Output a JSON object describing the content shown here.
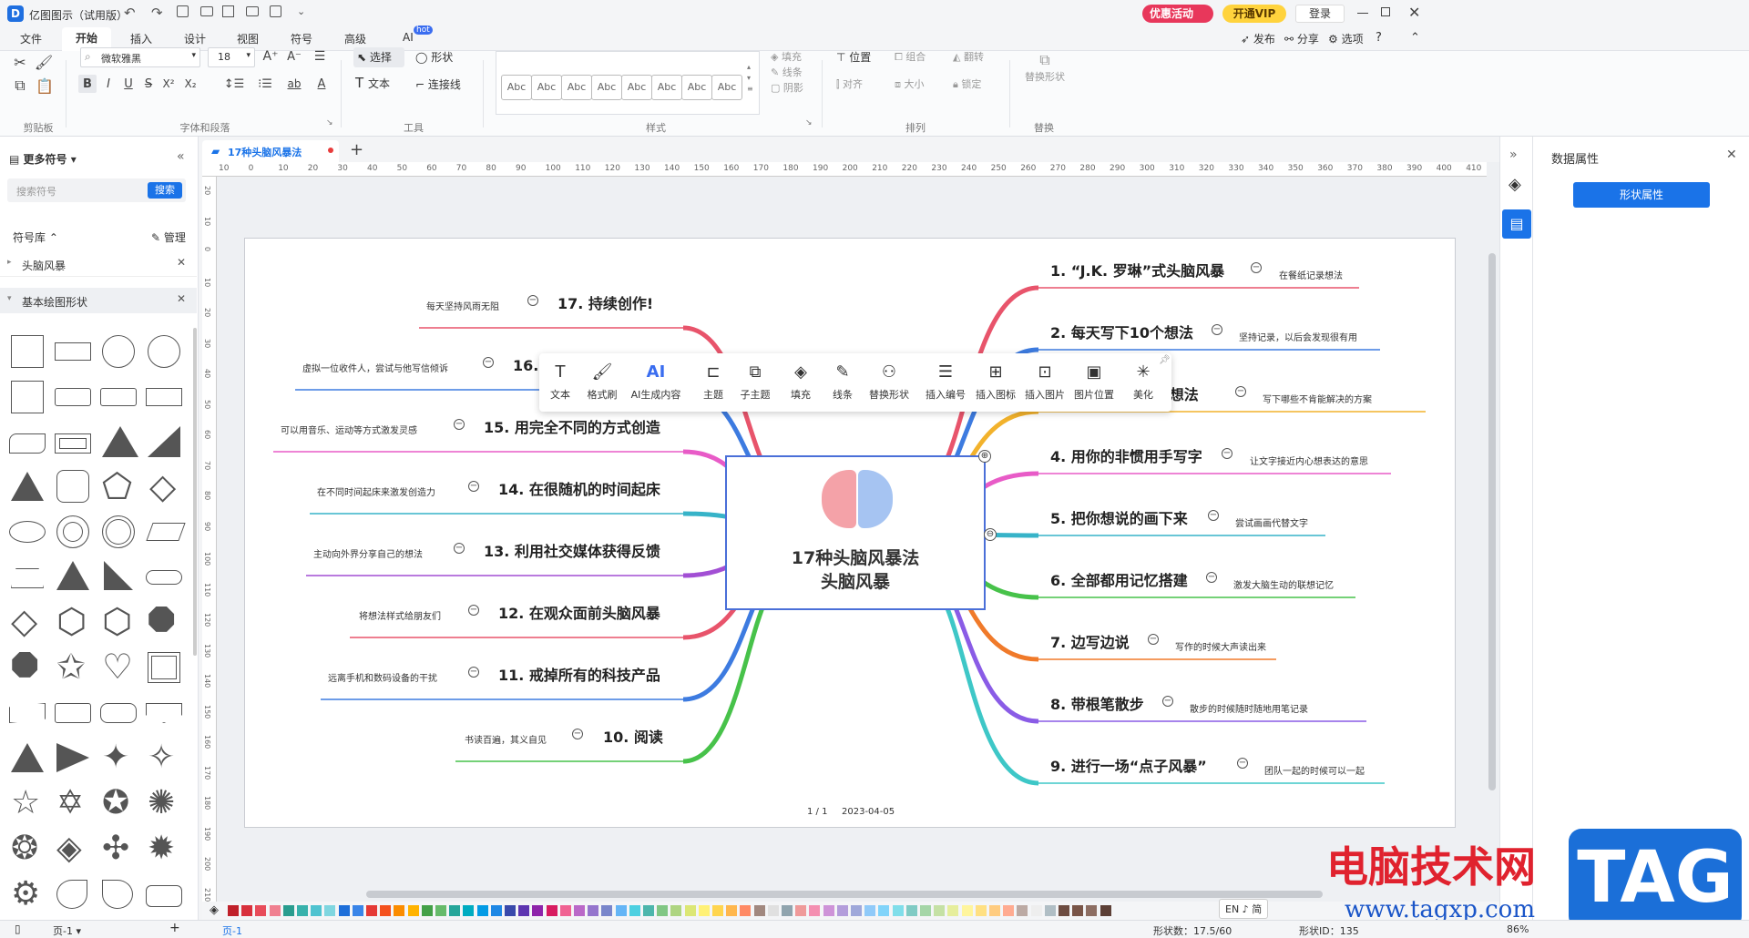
{
  "titlebar": {
    "app_title": "亿图图示（试用版）",
    "promo": "优惠活动",
    "vip": "开通VIP",
    "login": "登录"
  },
  "menu": {
    "items": [
      "文件",
      "开始",
      "插入",
      "设计",
      "视图",
      "符号",
      "高级",
      "AI"
    ],
    "ai_badge": "hot",
    "active": "开始",
    "right": [
      "发布",
      "分享",
      "选项"
    ]
  },
  "ribbon": {
    "font_name": "微软雅黑",
    "font_size": "18",
    "select": "选择",
    "shape": "形状",
    "text": "文本",
    "connector": "连接线",
    "fill": "填充",
    "line": "线条",
    "shadow": "阴影",
    "position": "位置",
    "group": "组合",
    "flip": "翻转",
    "align": "对齐",
    "size": "大小",
    "lock": "锁定",
    "replace_shape": "替换形状",
    "style_sample": "Abc",
    "groups": [
      "剪贴板",
      "字体和段落",
      "工具",
      "样式",
      "排列",
      "替换"
    ]
  },
  "left": {
    "more_symbols": "更多符号",
    "search_placeholder": "搜索符号",
    "search_btn": "搜索",
    "library": "符号库",
    "manage": "管理",
    "lib_items": [
      "头脑风暴",
      "基本绘图形状"
    ]
  },
  "tab": {
    "name": "17种头脑风暴法"
  },
  "ruler": {
    "ticks": [
      "10",
      "0",
      "10",
      "20",
      "30",
      "40",
      "50",
      "60",
      "70",
      "80",
      "90",
      "100",
      "110",
      "120",
      "130",
      "140",
      "150",
      "160",
      "170",
      "180",
      "190",
      "200",
      "210",
      "220",
      "230",
      "240",
      "250",
      "260",
      "270",
      "280",
      "290",
      "300",
      "310",
      "320",
      "330",
      "340",
      "350",
      "360",
      "370",
      "380",
      "390",
      "400",
      "410"
    ]
  },
  "vruler": {
    "ticks": [
      "20",
      "10",
      "0",
      "10",
      "20",
      "30",
      "40",
      "50",
      "60",
      "70",
      "80",
      "90",
      "100",
      "110",
      "120",
      "130",
      "140",
      "150",
      "160",
      "170",
      "180",
      "190",
      "200",
      "210"
    ]
  },
  "mindmap": {
    "center_line1": "17种头脑风暴法",
    "center_line2": "头脑风暴",
    "right_topics": [
      {
        "label": "1. “J.K. 罗琳”式头脑风暴",
        "note": "在餐纸记录想法",
        "color": "#e8546b"
      },
      {
        "label": "2. 每天写下10个想法",
        "note": "坚持记录，以后会发现很有用",
        "color": "#3d7be0"
      },
      {
        "label": "3. 列出不可能的想法",
        "note": "写下哪些不肯能解决的方案",
        "color": "#f2b22c"
      },
      {
        "label": "4. 用你的非惯用手写字",
        "note": "让文字接近内心想表达的意思",
        "color": "#e85bc7"
      },
      {
        "label": "5. 把你想说的画下来",
        "note": "尝试画画代替文字",
        "color": "#37b3c8"
      },
      {
        "label": "6. 全部都用记忆搭建",
        "note": "激发大脑生动的联想记忆",
        "color": "#47c24a"
      },
      {
        "label": "7. 边写边说",
        "note": "写作的时候大声读出来",
        "color": "#f07a2a"
      },
      {
        "label": "8. 带根笔散步",
        "note": "散步的时候随时随地用笔记录",
        "color": "#8a5ce6"
      },
      {
        "label": "9. 进行一场“点子风暴”",
        "note": "团队一起的时候可以一起",
        "color": "#3ec7c7"
      }
    ],
    "left_topics": [
      {
        "label": "17. 持续创作!",
        "note": "每天坚持风雨无阻",
        "color": "#e8546b"
      },
      {
        "label": "16. 写信给自己",
        "note": "虚拟一位收件人，尝试与他写信倾诉",
        "color": "#3d7be0"
      },
      {
        "label": "15. 用完全不同的方式创造",
        "note": "可以用音乐、运动等方式激发灵感",
        "color": "#e85bc7"
      },
      {
        "label": "14. 在很随机的时间起床",
        "note": "在不同时间起床来激发创造力",
        "color": "#37b3c8"
      },
      {
        "label": "13. 利用社交媒体获得反馈",
        "note": "主动向外界分享自己的想法",
        "color": "#a24fd4"
      },
      {
        "label": "12. 在观众面前头脑风暴",
        "note": "将想法样式给朋友们",
        "color": "#e8546b"
      },
      {
        "label": "11. 戒掉所有的科技产品",
        "note": "远离手机和数码设备的干扰",
        "color": "#3d7be0"
      },
      {
        "label": "10. 阅读",
        "note": "书读百遍，其义自见",
        "color": "#47c24a"
      }
    ],
    "page_info": "1 / 1",
    "date": "2023-04-05"
  },
  "float_toolbar": {
    "items": [
      "文本",
      "格式刷",
      "AI生成内容",
      "主题",
      "子主题",
      "填充",
      "线条",
      "替换形状",
      "插入编号",
      "插入图标",
      "插入图片",
      "图片位置",
      "美化"
    ]
  },
  "right": {
    "title": "数据属性",
    "button": "形状属性"
  },
  "status": {
    "page_tab": "页-1",
    "page_add": "页-1",
    "shape_count": "形状数：17.5/60",
    "shape_id": "形状ID：135",
    "zoom": "86%",
    "ime": "EN ♪ 简"
  },
  "watermark": {
    "text": "电脑技术网",
    "tag": "TAG",
    "url": "www.tagxp.com"
  }
}
